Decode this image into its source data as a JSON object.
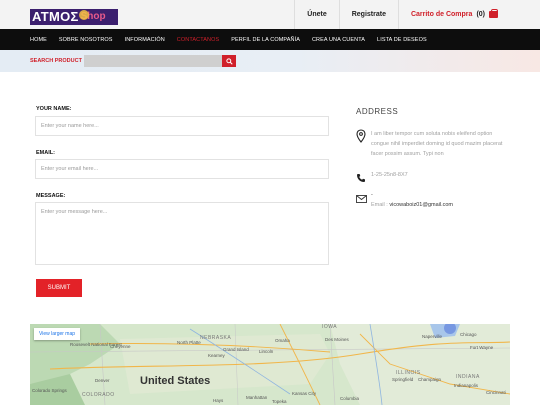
{
  "header": {
    "logo_main": "ATMOΣ",
    "logo_sub": "Shop",
    "login_label": "Únete",
    "register_label": "Registrate",
    "cart_label": "Carrito de Compra",
    "cart_count": "(0)"
  },
  "nav": {
    "items": [
      "HOME",
      "SOBRE NOSOTROS",
      "INFORMACIÓN",
      "CONTACTANOS",
      "PERFIL DE LA COMPAÑÍA",
      "CREA UNA CUENTA",
      "LISTA DE DESEOS"
    ],
    "active": "CONTACTANOS"
  },
  "search": {
    "label": "SEARCH PRODUCT",
    "placeholder": ""
  },
  "form": {
    "name_label": "YOUR NAME:",
    "name_placeholder": "Enter your name here...",
    "email_label": "EMAIL:",
    "email_placeholder": "Enter your email here...",
    "message_label": "MESSAGE:",
    "message_placeholder": "Enter your message here...",
    "submit_label": "SUBMIT"
  },
  "address": {
    "title": "ADDRESS",
    "text": "I am liber tempor cum soluta nobis eleifend option congue nihil imperdiet doming id quod mazim placerat facer possim assum. Typi non",
    "phone": "1-25-25n8-8X7",
    "email_dash": "-",
    "email_label": "Email :",
    "email_value": "vicowaboiz01@gmail.com"
  },
  "map": {
    "larger_map": "View larger map",
    "country": "United States",
    "labels": [
      "North Platte",
      "NEBRASKA",
      "Omaha",
      "IOWA",
      "Naperville",
      "Lincoln",
      "Des Moines",
      "Grand Island",
      "Kearney",
      "Chicago",
      "Fort Wayne",
      "Cheyenne",
      "COLORADO",
      "Denver",
      "Kansas City",
      "ILLINOIS",
      "INDIANA",
      "Springfield",
      "Champaign",
      "Indianapolis",
      "Cincinnati",
      "Columbia",
      "Manhattan",
      "Topeka",
      "Hays",
      "Colorado Springs",
      "Roosevelt National Forest"
    ]
  },
  "colors": {
    "accent": "#e32228",
    "nav_bg": "#0d0d0d",
    "logo_bg": "#3b1f6e"
  }
}
